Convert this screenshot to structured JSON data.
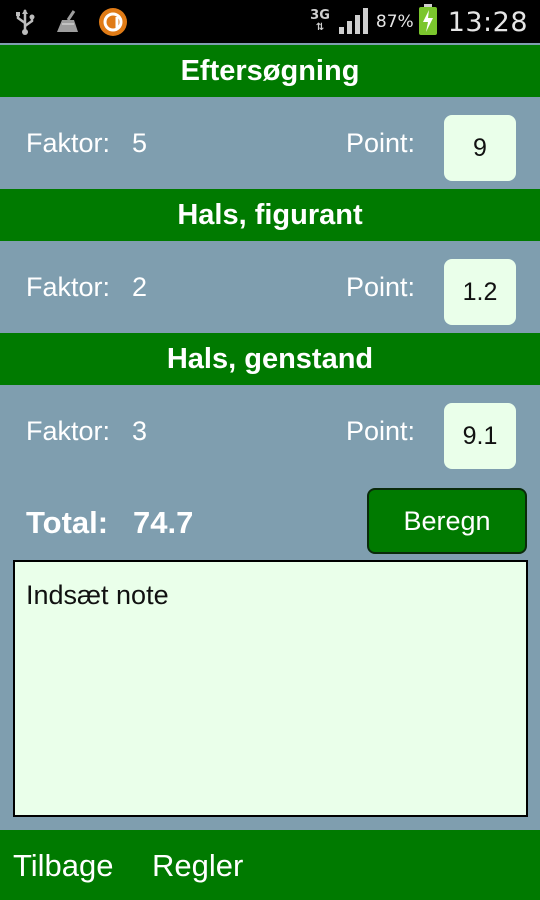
{
  "status_bar": {
    "network_type": "3G",
    "network_arrows": "⇅",
    "battery_percent": "87%",
    "time": "13:28",
    "icons": [
      "usb-icon",
      "cleaner-icon",
      "app-notification-icon",
      "signal-icon",
      "battery-charging-icon"
    ]
  },
  "sections": [
    {
      "title": "Eftersøgning",
      "factor_label": "Faktor:",
      "factor": "5",
      "point_label": "Point:",
      "point": "9"
    },
    {
      "title": "Hals, figurant",
      "factor_label": "Faktor:",
      "factor": "2",
      "point_label": "Point:",
      "point": "1.2"
    },
    {
      "title": "Hals, genstand",
      "factor_label": "Faktor:",
      "factor": "3",
      "point_label": "Point:",
      "point": "9.1"
    }
  ],
  "total": {
    "label": "Total:",
    "value": "74.7"
  },
  "calculate_button": {
    "label": "Beregn"
  },
  "note": {
    "placeholder": "Indsæt note"
  },
  "bottom_nav": {
    "back_label": "Tilbage",
    "rules_label": "Regler"
  },
  "colors": {
    "header_green": "#007a00",
    "background": "#7f9eaf",
    "input_background": "#eaffea",
    "status_bar": "#000000"
  }
}
